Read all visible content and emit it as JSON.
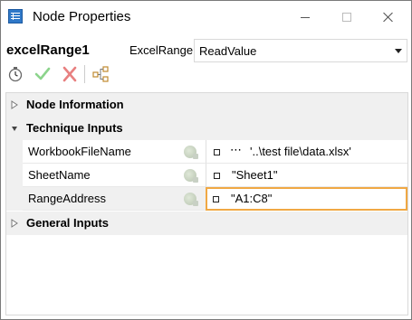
{
  "window": {
    "title": "Node Properties",
    "icon": "node-properties-icon"
  },
  "node": {
    "name": "excelRange1",
    "type_label": "ExcelRange",
    "method": "ReadValue"
  },
  "toolbar": {
    "icons": [
      "timer-icon",
      "check-icon",
      "x-icon",
      "tree-icon"
    ]
  },
  "grid": {
    "categories": [
      {
        "label": "Node Information",
        "expanded": false
      },
      {
        "label": "Technique Inputs",
        "expanded": true
      },
      {
        "label": "General Inputs",
        "expanded": false
      }
    ],
    "rows": [
      {
        "name": "WorkbookFileName",
        "value": "'..\\test file\\data.xlsx'",
        "has_ellipsis": true
      },
      {
        "name": "SheetName",
        "value": "\"Sheet1\"",
        "has_ellipsis": false
      },
      {
        "name": "RangeAddress",
        "value": "\"A1:C8\"",
        "has_ellipsis": false,
        "selected": true
      }
    ],
    "ellipsis": "⋯"
  },
  "colors": {
    "selection_border": "#f0a844",
    "category_bg": "#f0f0f0",
    "check_green": "#8cd48c",
    "x_red": "#e88080"
  }
}
